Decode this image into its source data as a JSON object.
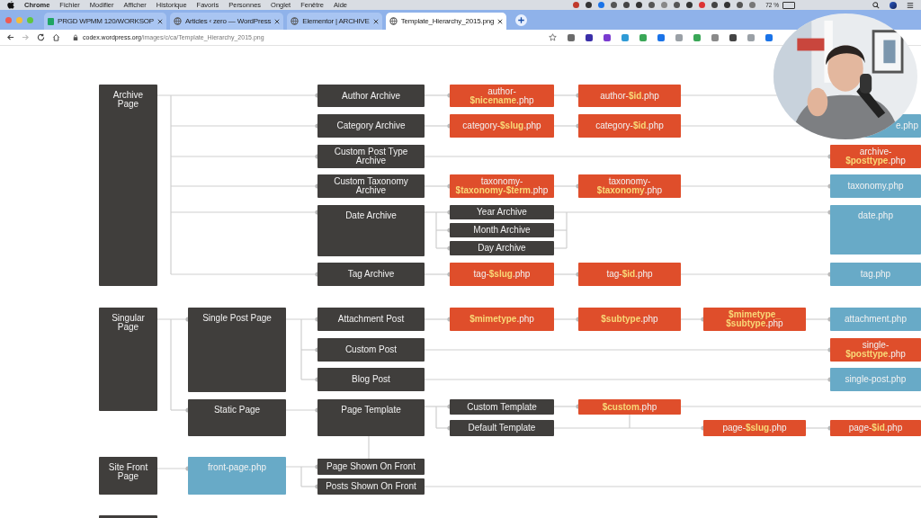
{
  "browser": {
    "menu_bar": [
      "Chrome",
      "Fichier",
      "Modifier",
      "Afficher",
      "Historique",
      "Favoris",
      "Personnes",
      "Onglet",
      "Fenêtre",
      "Aide"
    ],
    "battery": "72 %",
    "tabs": [
      {
        "title": "PRGD WPMM 120/WORKSOP",
        "selected": false
      },
      {
        "title": "Articles ‹ zero — WordPress",
        "selected": false
      },
      {
        "title": "Elementor | ARCHIVE",
        "selected": false
      },
      {
        "title": "Template_Hierarchy_2015.png",
        "selected": true
      }
    ],
    "address_domain": "codex.wordpress.org",
    "address_path": "/images/c/ca/Template_Hierarchy_2015.png"
  },
  "diagram": {
    "nodes": [
      {
        "kind": "dark",
        "label": "Archive\nPage"
      },
      {
        "kind": "dark",
        "label": "Author Archive"
      },
      {
        "kind": "orange",
        "label": "author-\n**$nicename**.php"
      },
      {
        "kind": "orange",
        "label": "author-**$id**.php"
      },
      {
        "kind": "dark",
        "label": "Category Archive"
      },
      {
        "kind": "orange",
        "label": "category-**$slug**.php"
      },
      {
        "kind": "orange",
        "label": "category-**$id**.php"
      },
      {
        "kind": "blue",
        "label": "e.php"
      },
      {
        "kind": "dark",
        "label": "Custom Post Type\nArchive"
      },
      {
        "kind": "orange",
        "label": "archive-\n**$posttype**.php"
      },
      {
        "kind": "dark",
        "label": "Custom Taxonomy\nArchive"
      },
      {
        "kind": "orange",
        "label": "taxonomy-\n**$taxonomy-$term**.php"
      },
      {
        "kind": "orange",
        "label": "taxonomy-\n**$taxonomy**.php"
      },
      {
        "kind": "blue",
        "label": "taxonomy.php"
      },
      {
        "kind": "dark",
        "label": "Date Archive"
      },
      {
        "kind": "dark",
        "label": "Year Archive"
      },
      {
        "kind": "dark",
        "label": "Month Archive"
      },
      {
        "kind": "dark",
        "label": "Day Archive"
      },
      {
        "kind": "blue",
        "label": "date.php"
      },
      {
        "kind": "dark",
        "label": "Tag Archive"
      },
      {
        "kind": "orange",
        "label": "tag-**$slug**.php"
      },
      {
        "kind": "orange",
        "label": "tag-**$id**.php"
      },
      {
        "kind": "blue",
        "label": "tag.php"
      },
      {
        "kind": "dark",
        "label": "Singular\nPage"
      },
      {
        "kind": "dark",
        "label": "Single Post Page"
      },
      {
        "kind": "dark",
        "label": "Attachment Post"
      },
      {
        "kind": "orange",
        "label": "**$mimetype**.php"
      },
      {
        "kind": "orange",
        "label": "**$subtype**.php"
      },
      {
        "kind": "orange",
        "label": "**$mimetype_**\n**$subtype**.php"
      },
      {
        "kind": "blue",
        "label": "attachment.php"
      },
      {
        "kind": "dark",
        "label": "Custom Post"
      },
      {
        "kind": "orange",
        "label": "single-\n**$posttype**.php"
      },
      {
        "kind": "dark",
        "label": "Blog Post"
      },
      {
        "kind": "blue",
        "label": "single-post.php"
      },
      {
        "kind": "dark",
        "label": "Static Page"
      },
      {
        "kind": "dark",
        "label": "Page Template"
      },
      {
        "kind": "dark",
        "label": "Custom Template"
      },
      {
        "kind": "orange",
        "label": "**$custom**.php"
      },
      {
        "kind": "dark",
        "label": "Default Template"
      },
      {
        "kind": "orange",
        "label": "page-**$slug**.php"
      },
      {
        "kind": "orange",
        "label": "page-**$id**.php"
      },
      {
        "kind": "dark",
        "label": "Site Front\nPage"
      },
      {
        "kind": "blue",
        "label": "front-page.php"
      },
      {
        "kind": "dark",
        "label": "Page Shown On Front"
      },
      {
        "kind": "dark",
        "label": "Posts Shown On Front"
      },
      {
        "kind": "dark"
      }
    ]
  }
}
